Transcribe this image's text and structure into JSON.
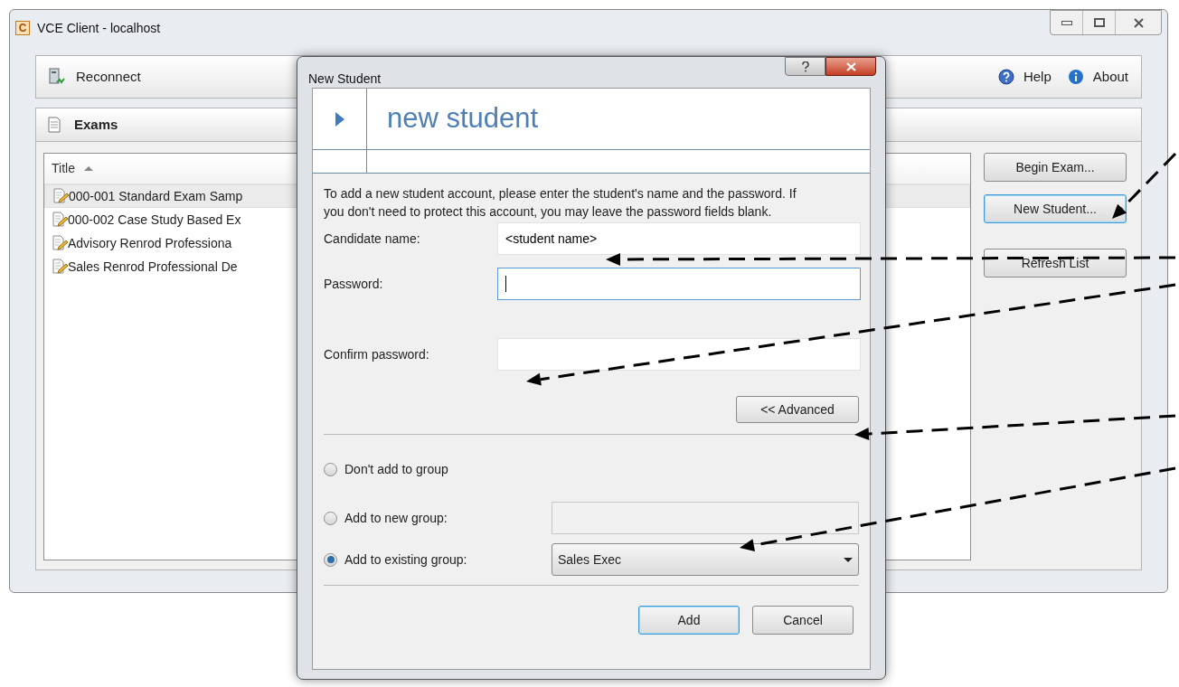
{
  "window": {
    "title": "VCE Client - localhost",
    "logo": "C"
  },
  "toolbar": {
    "left": [
      {
        "label": "Reconnect"
      }
    ],
    "right": [
      {
        "label": "Help"
      },
      {
        "label": "About"
      }
    ]
  },
  "section": {
    "title": "Exams"
  },
  "table": {
    "columns": [
      {
        "label": "Title",
        "sorted": true
      }
    ],
    "rows": [
      {
        "title": "000-001 Standard Exam Samp",
        "selected": true
      },
      {
        "title": "000-002 Case Study Based Ex",
        "selected": false
      },
      {
        "title": "Advisory Renrod Professiona",
        "selected": false
      },
      {
        "title": "Sales Renrod Professional De",
        "selected": false
      }
    ]
  },
  "side_buttons": [
    {
      "label": "Begin Exam...",
      "default": false
    },
    {
      "label": "New Student...",
      "default": true
    },
    {
      "label": "Refresh List",
      "default": false
    }
  ],
  "dialog": {
    "title": "New Student",
    "banner": "new student",
    "intro": "To add a new student account, please enter the student's name and the password. If you don't need to protect this account, you may leave the password fields blank.",
    "fields": [
      {
        "label": "Candidate name:",
        "value": "<student name>",
        "focused": false
      },
      {
        "label": "Password:",
        "focused": true
      },
      {
        "label": "Confirm password:",
        "focused": false
      }
    ],
    "advanced_button": "<< Advanced",
    "groups": [
      {
        "kind": "plain",
        "label": "Don't add to group",
        "selected": false
      },
      {
        "kind": "text",
        "label": "Add to new group:",
        "selected": false
      },
      {
        "kind": "select",
        "label": "Add to existing group:",
        "selected": true,
        "value": "Sales Exec"
      }
    ],
    "buttons": [
      {
        "label": "Add",
        "default": true
      },
      {
        "label": "Cancel",
        "default": false
      }
    ]
  }
}
